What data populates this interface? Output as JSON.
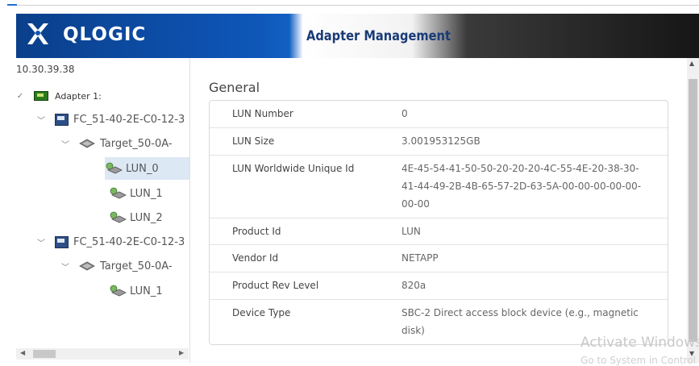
{
  "banner": {
    "brand_name": "QLOGIC",
    "title": "Adapter Management"
  },
  "tree": {
    "host": "10.30.39.38",
    "adapter_label": "Adapter 1:",
    "port1_label": "FC_51-40-2E-C0-12-3",
    "target1_label": "Target_50-0A-",
    "lun_a": "LUN_0",
    "lun_b": "LUN_1",
    "lun_c": "LUN_2",
    "port2_label": "FC_51-40-2E-C0-12-3",
    "target2_label": "Target_50-0A-",
    "lun_d": "LUN_1"
  },
  "details": {
    "section_title": "General",
    "rows": [
      {
        "key": "LUN Number",
        "value": "0"
      },
      {
        "key": "LUN Size",
        "value": "3.001953125GB"
      },
      {
        "key": "LUN Worldwide Unique Id",
        "value": "4E-45-54-41-50-50-20-20-20-4C-55-4E-20-38-30-41-44-49-2B-4B-65-57-2D-63-5A-00-00-00-00-00-00-00"
      },
      {
        "key": "Product Id",
        "value": "LUN"
      },
      {
        "key": "Vendor Id",
        "value": "NETAPP"
      },
      {
        "key": "Product Rev Level",
        "value": "820a"
      },
      {
        "key": "Device Type",
        "value": "SBC-2 Direct access block device (e.g., magnetic disk)"
      }
    ]
  },
  "watermark": {
    "line1": "Activate Windows",
    "line2": "Go to System in Control"
  },
  "colors": {
    "brand_blue": "#0e56b8",
    "title_blue": "#1a3b78",
    "selection": "#dde8f5"
  }
}
